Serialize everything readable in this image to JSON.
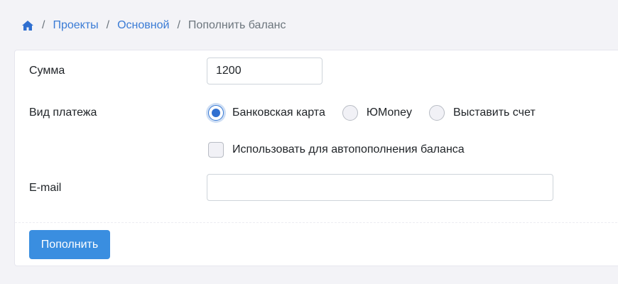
{
  "breadcrumb": {
    "home_icon": "home-icon",
    "separator": "/",
    "items": [
      "Проекты",
      "Основной"
    ],
    "current": "Пополнить баланс"
  },
  "form": {
    "amount": {
      "label": "Сумма",
      "value": "1200"
    },
    "payment_type": {
      "label": "Вид платежа",
      "options": [
        "Банковская карта",
        "ЮMoney",
        "Выставить счет"
      ],
      "selected": "Банковская карта"
    },
    "autorefill": {
      "label": "Использовать для автопополнения баланса",
      "checked": false
    },
    "email": {
      "label": "E-mail",
      "value": ""
    }
  },
  "actions": {
    "submit_label": "Пополнить"
  },
  "colors": {
    "accent": "#3a8ee0",
    "link": "#3a7bd5",
    "background": "#f3f3f7"
  }
}
